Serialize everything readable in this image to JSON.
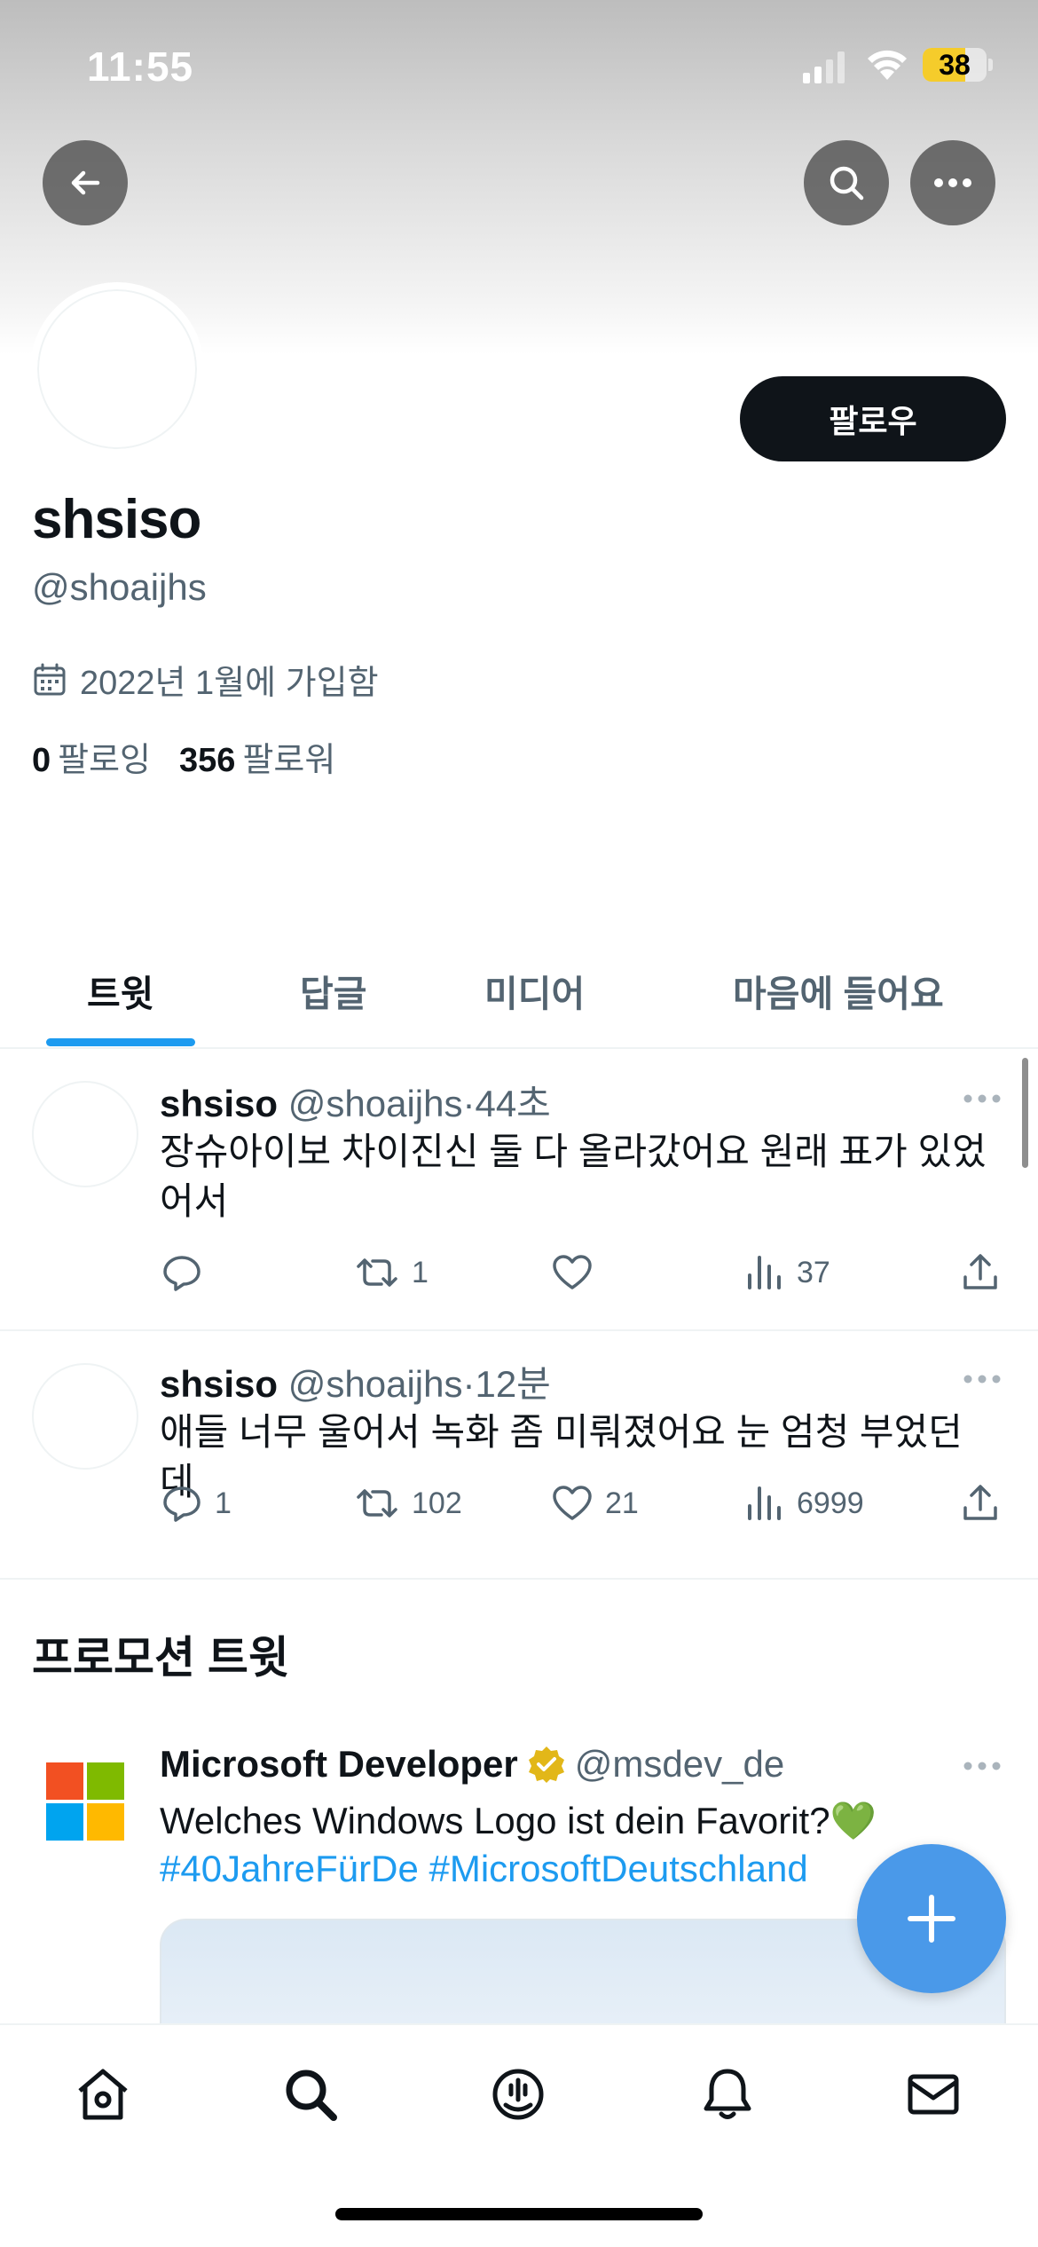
{
  "status_bar": {
    "time": "11:55",
    "battery": "38"
  },
  "nav": {
    "back_icon": "arrow-left-icon",
    "search_icon": "search-icon",
    "more_icon": "more-horizontal-icon"
  },
  "profile": {
    "follow_label": "팔로우",
    "name": "shsiso",
    "handle": "@shoaijhs",
    "joined": "2022년 1월에 가입함",
    "following_count": "0",
    "following_label": "팔로잉",
    "followers_count": "356",
    "followers_label": "팔로워"
  },
  "tabs": [
    {
      "label": "트윗",
      "active": true
    },
    {
      "label": "답글",
      "active": false
    },
    {
      "label": "미디어",
      "active": false
    },
    {
      "label": "마음에 들어요",
      "active": false
    }
  ],
  "tweets": [
    {
      "name": "shsiso",
      "handle": "@shoaijhs",
      "time": "44초",
      "text_line1": "장슈아이보 차이진신 둘 다 올라갔어요 원래 표가 있었",
      "text_line2": "어서",
      "replies": "",
      "retweets": "1",
      "likes": "",
      "views": "37"
    },
    {
      "name": "shsiso",
      "handle": "@shoaijhs",
      "time": "12분",
      "text_line1": "애들 너무 울어서 녹화 좀 미뤄졌어요 눈 엄청 부었던데",
      "replies": "1",
      "retweets": "102",
      "likes": "21",
      "views": "6999"
    }
  ],
  "promoted": {
    "section_title": "프로모션 트윗",
    "name": "Microsoft Developer",
    "handle": "@msdev_de",
    "text": "Welches Windows Logo ist dein Favorit?💚",
    "hashtags": "#40JahreFürDe #MicrosoftDeutschland",
    "logo_colors": [
      "#f25022",
      "#7fba00",
      "#00a4ef",
      "#ffb900"
    ],
    "verified_color": "#e2b719"
  },
  "fab": {
    "icon": "plus-icon"
  },
  "tabbar": [
    "home-icon",
    "search-icon",
    "spaces-icon",
    "bell-icon",
    "mail-icon"
  ],
  "colors": {
    "accent": "#1d9bf0",
    "text": "#0f1419",
    "muted": "#536471"
  }
}
